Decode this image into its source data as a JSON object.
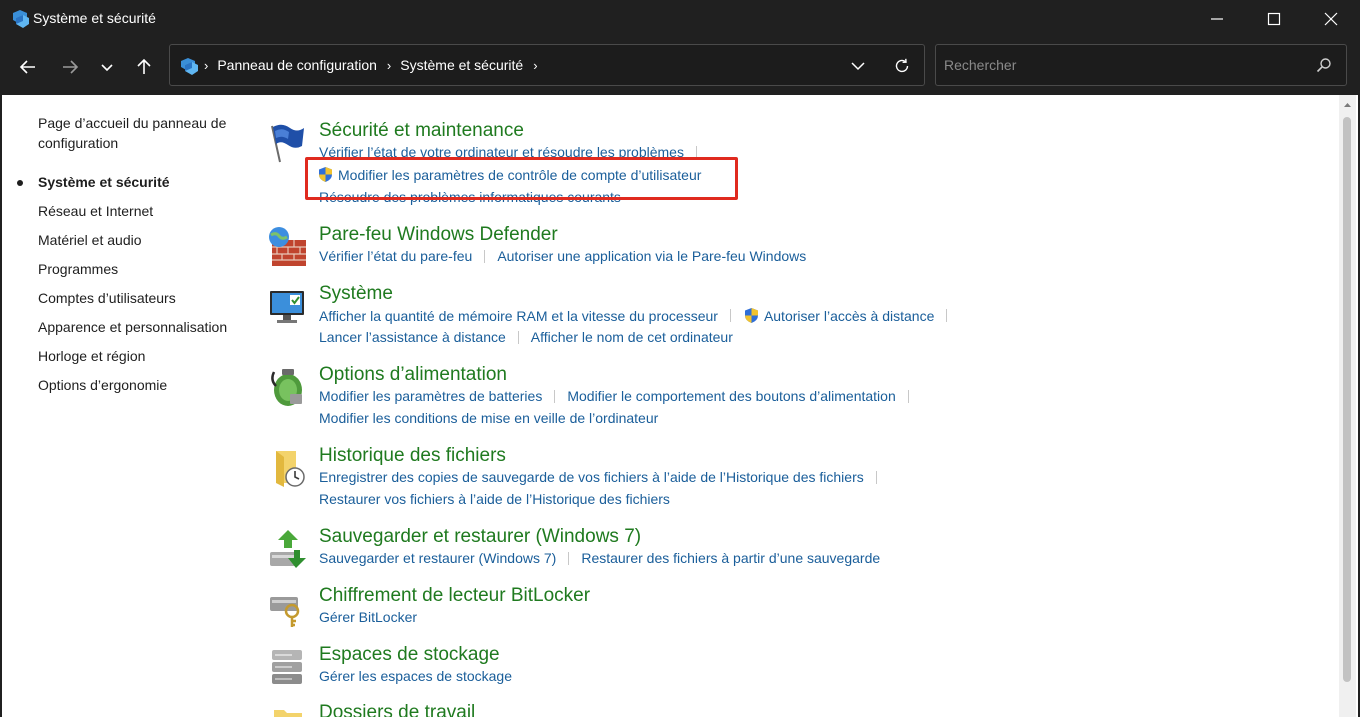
{
  "window": {
    "title": "Système et sécurité"
  },
  "nav": {
    "breadcrumbs": [
      "Panneau de configuration",
      "Système et sécurité"
    ],
    "search_placeholder": "Rechercher"
  },
  "sidebar": {
    "home": "Page d’accueil du panneau de configuration",
    "items": [
      {
        "label": "Système et sécurité",
        "active": true
      },
      {
        "label": "Réseau et Internet",
        "active": false
      },
      {
        "label": "Matériel et audio",
        "active": false
      },
      {
        "label": "Programmes",
        "active": false
      },
      {
        "label": "Comptes d’utilisateurs",
        "active": false
      },
      {
        "label": "Apparence et personnalisation",
        "active": false
      },
      {
        "label": "Horloge et région",
        "active": false
      },
      {
        "label": "Options d’ergonomie",
        "active": false
      }
    ]
  },
  "categories": [
    {
      "title": "Sécurité et maintenance",
      "icon": "flag-icon",
      "links": [
        "Vérifier l’état de votre ordinateur et résoudre les problèmes",
        "Modifier les paramètres de contrôle de compte d’utilisateur",
        "Résoudre des problèmes informatiques courants"
      ]
    },
    {
      "title": "Pare-feu Windows Defender",
      "icon": "firewall-icon",
      "links": [
        "Vérifier l’état du pare-feu",
        "Autoriser une application via le Pare-feu Windows"
      ]
    },
    {
      "title": "Système",
      "icon": "monitor-icon",
      "links": [
        "Afficher la quantité de mémoire RAM et la vitesse du processeur",
        "Autoriser l’accès à distance",
        "Lancer l’assistance à distance",
        "Afficher le nom de cet ordinateur"
      ]
    },
    {
      "title": "Options d’alimentation",
      "icon": "battery-icon",
      "links": [
        "Modifier les paramètres de batteries",
        "Modifier le comportement des boutons d’alimentation",
        "Modifier les conditions de mise en veille de l’ordinateur"
      ]
    },
    {
      "title": "Historique des fichiers",
      "icon": "file-history-icon",
      "links": [
        "Enregistrer des copies de sauvegarde de vos fichiers à l’aide de l’Historique des fichiers",
        "Restaurer vos fichiers à l’aide de l’Historique des fichiers"
      ]
    },
    {
      "title": "Sauvegarder et restaurer (Windows 7)",
      "icon": "backup-icon",
      "links": [
        "Sauvegarder et restaurer (Windows 7)",
        "Restaurer des fichiers à partir d’une sauvegarde"
      ]
    },
    {
      "title": "Chiffrement de lecteur BitLocker",
      "icon": "bitlocker-icon",
      "links": [
        "Gérer BitLocker"
      ]
    },
    {
      "title": "Espaces de stockage",
      "icon": "storage-icon",
      "links": [
        "Gérer les espaces de stockage"
      ]
    },
    {
      "title": "Dossiers de travail",
      "icon": "work-folders-icon",
      "links": []
    }
  ],
  "colors": {
    "category_title": "#1f7a1f",
    "link": "#1a5e9a",
    "highlight": "#e02a1f",
    "titlebar": "#202020"
  }
}
